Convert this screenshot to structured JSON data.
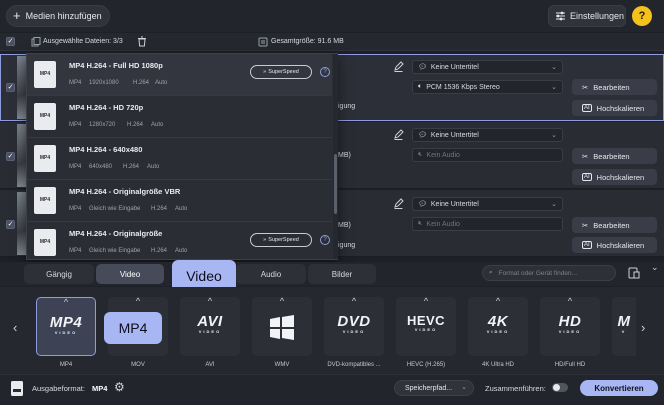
{
  "toolbar": {
    "add_media": "Medien hinzufügen",
    "settings": "Einstellungen",
    "help": "?"
  },
  "info": {
    "selected_files": "Ausgewählte Dateien: 3/3",
    "total_size": "Gesamtgröße: 91.6 MB"
  },
  "rows": [
    {
      "subtitle": "Keine Untertitel",
      "audio": "PCM 1536 Kbps Stereo",
      "edit": "Bearbeiten",
      "upscale": "Hochskalieren",
      "partial_left": "igung",
      "partial_size": ""
    },
    {
      "subtitle": "Keine Untertitel",
      "audio": "Kein Audio",
      "edit": "Bearbeiten",
      "upscale": "Hochskalieren",
      "partial_left": "",
      "partial_size": "MB)"
    },
    {
      "subtitle": "Keine Untertitel",
      "audio": "Kein Audio",
      "edit": "Bearbeiten",
      "upscale": "Hochskalieren",
      "partial_left": "igung",
      "partial_size": "MB)"
    }
  ],
  "dropdown": {
    "items": [
      {
        "title": "MP4 H.264 - Full HD 1080p",
        "format": "MP4",
        "res": "1920x1080",
        "codec": "H.264",
        "fps": "Auto",
        "superspeed": true
      },
      {
        "title": "MP4 H.264 - HD 720p",
        "format": "MP4",
        "res": "1280x720",
        "codec": "H.264",
        "fps": "Auto",
        "superspeed": false
      },
      {
        "title": "MP4 H.264 - 640x480",
        "format": "MP4",
        "res": "640x480",
        "codec": "H.264",
        "fps": "Auto",
        "superspeed": false
      },
      {
        "title": "MP4 H.264 - Originalgröße VBR",
        "format": "MP4",
        "res": "Gleich wie Eingabe",
        "codec": "H.264",
        "fps": "Auto",
        "superspeed": false
      },
      {
        "title": "MP4 H.264 - Originalgröße",
        "format": "MP4",
        "res": "Gleich wie Eingabe",
        "codec": "H.264",
        "fps": "Auto",
        "superspeed": true
      }
    ],
    "superspeed_label": "SuperSpeed",
    "icon_text": "MP4"
  },
  "tabs": [
    "Gängig",
    "Video",
    "Audio",
    "Bilder"
  ],
  "active_tab": "Video",
  "search_placeholder": "Format oder Gerät finden...",
  "callouts": {
    "video": "Video",
    "mp4": "MP4"
  },
  "formats": [
    {
      "logo": "MP4",
      "sub": "VIDEO",
      "label": "MP4"
    },
    {
      "logo": "",
      "sub": "",
      "label": "MOV"
    },
    {
      "logo": "AVI",
      "sub": "VIDEO",
      "label": "AVI"
    },
    {
      "logo": "",
      "sub": "",
      "label": "WMV"
    },
    {
      "logo": "DVD",
      "sub": "VIDEO",
      "label": "DVD-kompatibles ..."
    },
    {
      "logo": "HEVC",
      "sub": "VIDEO",
      "label": "HEVC (H.265)"
    },
    {
      "logo": "4K",
      "sub": "VIDEO",
      "label": "4K Ultra HD"
    },
    {
      "logo": "HD",
      "sub": "VIDEO",
      "label": "HD/Full HD"
    },
    {
      "logo": "M",
      "sub": "V",
      "label": ""
    }
  ],
  "footer": {
    "output_label": "Ausgabeformat:",
    "output_value": "MP4",
    "save_path": "Speicherpfad...",
    "merge": "Zusammenführen:",
    "convert": "Konvertieren"
  },
  "colors": {
    "accent": "#a9b6f4",
    "help": "#f5c21b",
    "bg": "#1e2027"
  }
}
